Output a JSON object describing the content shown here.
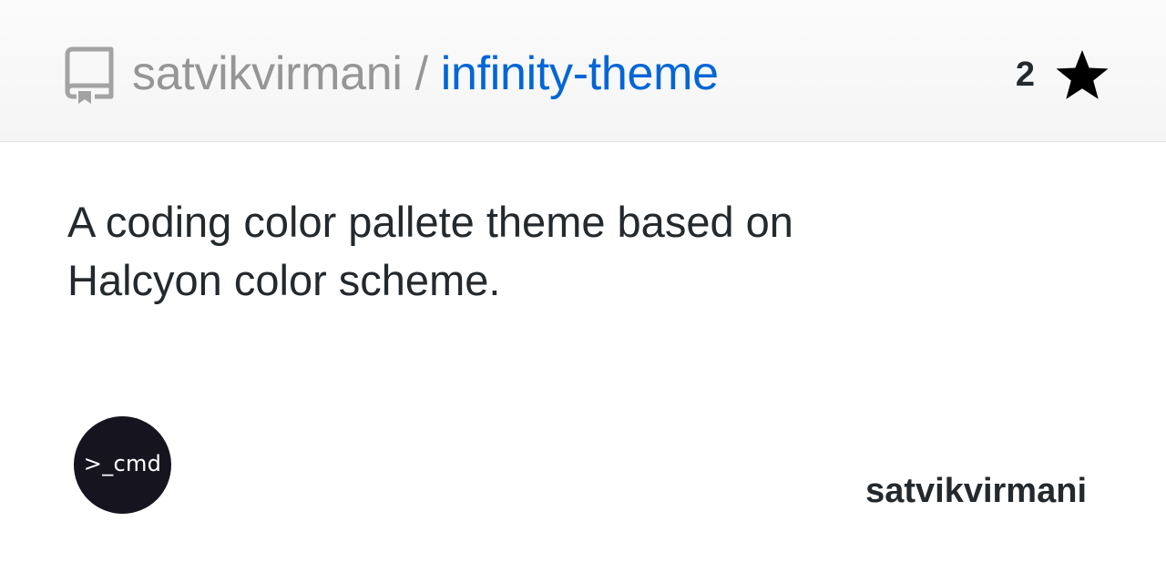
{
  "header": {
    "owner": "satvikvirmani",
    "separator": "/",
    "repo_name": "infinity-theme",
    "star_count": "2",
    "repo_icon": "repo-icon",
    "star_icon": "star-icon"
  },
  "description": "A coding color pallete theme based on Halcyon color scheme.",
  "footer": {
    "avatar_text": ">_cmd",
    "username": "satvikvirmani"
  },
  "colors": {
    "link": "#0366d6",
    "muted": "#969696",
    "text": "#24292e",
    "avatar_bg": "#16151f"
  }
}
